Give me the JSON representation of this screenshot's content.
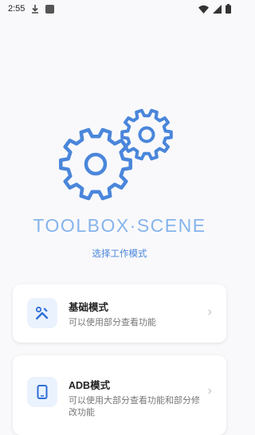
{
  "status_bar": {
    "time": "2:55",
    "download_icon": "download-icon",
    "app_icon": "app-icon",
    "wifi_icon": "wifi-icon",
    "signal_icon": "signal-icon",
    "battery_icon": "battery-icon"
  },
  "header": {
    "logo_icon": "gears-icon",
    "title": "TOOLBOX·SCENE",
    "subtitle": "选择工作模式",
    "accent_color": "#4a86db"
  },
  "modes": [
    {
      "title": "基础模式",
      "description": "可以使用部分查看功能",
      "icon": "tools-icon"
    },
    {
      "title": "ADB模式",
      "description": "可以使用大部分查看功能和部分修改功能",
      "icon": "phone-icon"
    }
  ]
}
